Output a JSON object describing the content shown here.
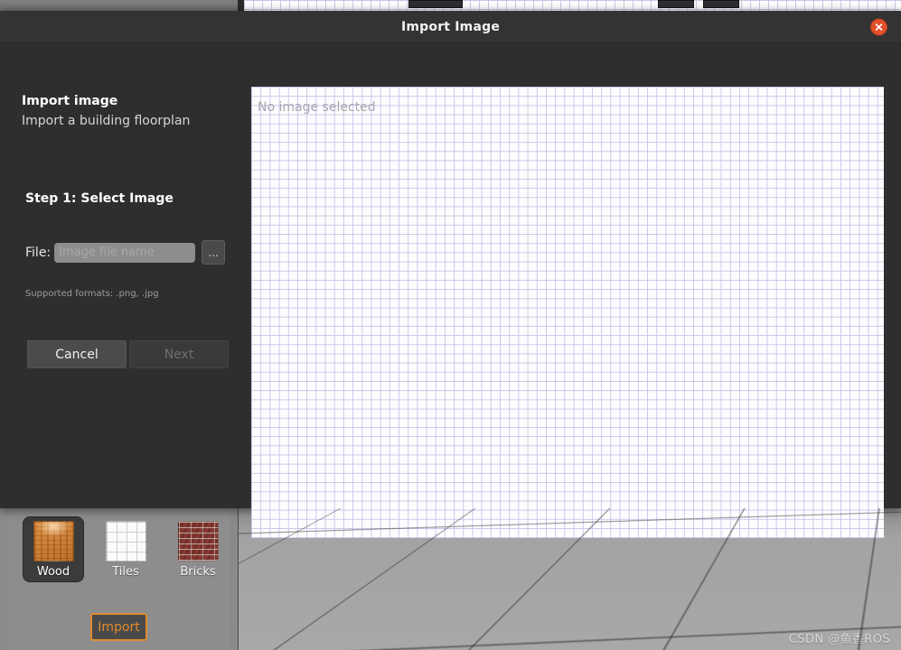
{
  "background_app": {
    "material_palette": {
      "name": "material-palette",
      "items": [
        {
          "label": "Wood",
          "texture": "tex-wood",
          "selected": true
        },
        {
          "label": "Tiles",
          "texture": "tex-tiles",
          "selected": false
        },
        {
          "label": "Bricks",
          "texture": "tex-bricks",
          "selected": false
        }
      ]
    },
    "import_button_label": "Import",
    "import_button_accent": "#e08b30",
    "watermark": "CSDN @鱼香ROS"
  },
  "dialog": {
    "title": "Import Image",
    "close_icon": "close-icon",
    "close_color": "#e2502a",
    "heading": "Import image",
    "subheading": "Import a building floorplan",
    "step_title": "Step 1: Select Image",
    "file": {
      "label": "File:",
      "value": "",
      "placeholder": "Image file name",
      "browse_label": "...",
      "browse_icon": "ellipsis-icon"
    },
    "supported_formats": "Supported formats: .png, .jpg",
    "buttons": {
      "cancel": "Cancel",
      "next": "Next"
    },
    "preview": {
      "placeholder": "No image selected"
    }
  }
}
